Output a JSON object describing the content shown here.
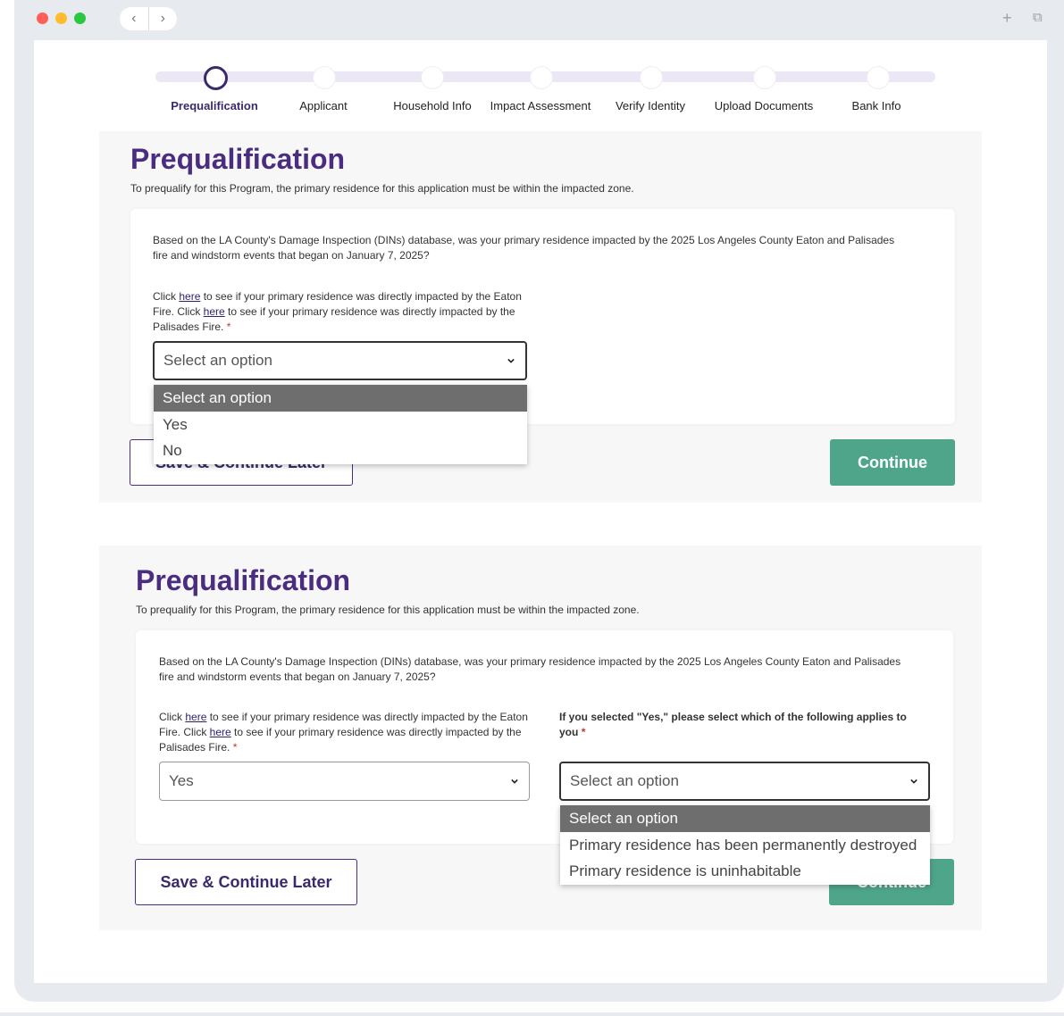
{
  "browser": {
    "traffic_lights": [
      "#ff5f57",
      "#febc2e",
      "#28c840"
    ],
    "back_icon": "‹",
    "forward_icon": "›",
    "new_tab_icon": "+",
    "window_icon": "⧉"
  },
  "stepper": {
    "steps": [
      {
        "label": "Prequalification",
        "active": true
      },
      {
        "label": "Applicant"
      },
      {
        "label": "Household Info"
      },
      {
        "label": "Impact Assessment"
      },
      {
        "label": "Verify Identity"
      },
      {
        "label": "Upload Documents"
      },
      {
        "label": "Bank Info"
      }
    ]
  },
  "section1": {
    "title": "Prequalification",
    "subtitle": "To prequalify for this Program, the primary residence for this application must be within the impacted zone.",
    "question": "Based on the LA County's Damage Inspection (DINs) database, was your primary residence impacted by the 2025 Los Angeles County Eaton and Palisades fire and windstorm events that began on January 7, 2025?",
    "click_text_1": "Click ",
    "link_1": "here",
    "click_text_2": " to see if your primary residence was directly impacted by the Eaton Fire. Click ",
    "link_2": "here",
    "click_text_3": " to see if your primary residence was directly impacted by the Palisades Fire.",
    "required_mark": "*",
    "select_value": "Select an option",
    "dropdown_options": [
      "Select an option",
      "Yes",
      "No"
    ],
    "save_label": "Save & Continue Later",
    "continue_label": "Continue"
  },
  "section2": {
    "title": "Prequalification",
    "subtitle": "To prequalify for this Program, the primary residence for this application must be within the impacted zone.",
    "question": "Based on the LA County's Damage Inspection (DINs) database, was your primary residence impacted by the 2025 Los Angeles County Eaton and Palisades fire and windstorm events that began on January 7, 2025?",
    "click_text_1": "Click ",
    "link_1": "here",
    "click_text_2": " to see if your primary residence was directly impacted by the Eaton Fire. Click ",
    "link_2": "here",
    "click_text_3": " to see if your primary residence was directly impacted by the Palisades Fire.",
    "required_mark": "*",
    "select_value": "Yes",
    "followup_label": "If you selected \"Yes,\" please select which of the following applies to you",
    "followup_value": "Select an option",
    "dropdown_options": [
      "Select an option",
      "Primary residence has been permanently destroyed",
      "Primary residence is uninhabitable"
    ],
    "save_label": "Save & Continue Later",
    "continue_label": "Continue"
  }
}
